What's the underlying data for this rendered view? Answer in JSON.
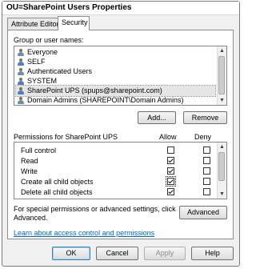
{
  "window": {
    "title": "OU=SharePoint Users Properties"
  },
  "tabs": [
    {
      "label": "Attribute Editor",
      "active": false
    },
    {
      "label": "Security",
      "active": true
    }
  ],
  "groups": {
    "label": "Group or user names:",
    "items": [
      {
        "name": "Everyone",
        "icon": "group-icon"
      },
      {
        "name": "SELF",
        "icon": "user-icon"
      },
      {
        "name": "Authenticated Users",
        "icon": "group-icon"
      },
      {
        "name": "SYSTEM",
        "icon": "user-icon"
      },
      {
        "name": "SharePoint UPS (spups@sharepoint.com)",
        "icon": "user-icon",
        "selected": true
      },
      {
        "name": "Domain Admins (SHAREPOINT\\Domain Admins)",
        "icon": "group-icon"
      }
    ],
    "add_label": "Add...",
    "remove_label": "Remove"
  },
  "permissions": {
    "title": "Permissions for SharePoint UPS",
    "allow_label": "Allow",
    "deny_label": "Deny",
    "rows": [
      {
        "name": "Full control",
        "allow": false,
        "deny": false
      },
      {
        "name": "Read",
        "allow": true,
        "deny": false
      },
      {
        "name": "Write",
        "allow": true,
        "deny": false
      },
      {
        "name": "Create all child objects",
        "allow": true,
        "deny": false
      },
      {
        "name": "Delete all child objects",
        "allow": true,
        "deny": false
      }
    ]
  },
  "advanced": {
    "text_line1": "For special permissions or advanced settings, click",
    "text_line2": "Advanced.",
    "button_label": "Advanced"
  },
  "link_text": "Learn about access control and permissions",
  "footer": {
    "ok": "OK",
    "cancel": "Cancel",
    "apply": "Apply",
    "help": "Help"
  }
}
